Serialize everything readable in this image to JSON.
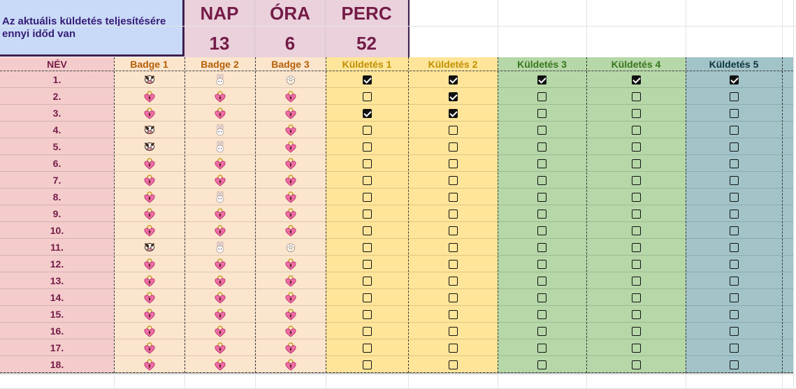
{
  "timer": {
    "info_text": "Az aktuális küldetés teljesítésére ennyi időd van",
    "units": [
      {
        "label": "NAP",
        "value": "13"
      },
      {
        "label": "ÓRA",
        "value": "6"
      },
      {
        "label": "PERC",
        "value": "52"
      }
    ]
  },
  "columns": [
    {
      "key": "name",
      "label": "NÉV",
      "color": "#741b47",
      "bg": "#f4cccc"
    },
    {
      "key": "badge1",
      "label": "Badge 1",
      "color": "#b45f06",
      "bg": "#fce5cd"
    },
    {
      "key": "badge2",
      "label": "Badge 2",
      "color": "#b45f06",
      "bg": "#fce5cd"
    },
    {
      "key": "badge3",
      "label": "Badge 3",
      "color": "#b45f06",
      "bg": "#fce5cd"
    },
    {
      "key": "mission1",
      "label": "Küldetés 1",
      "color": "#bf9000",
      "bg": "#ffe599"
    },
    {
      "key": "mission2",
      "label": "Küldetés 2",
      "color": "#bf9000",
      "bg": "#ffe599"
    },
    {
      "key": "mission3",
      "label": "Küldetés 3",
      "color": "#38761d",
      "bg": "#b6d7a8"
    },
    {
      "key": "mission4",
      "label": "Küldetés 4",
      "color": "#38761d",
      "bg": "#b6d7a8"
    },
    {
      "key": "mission5",
      "label": "Küldetés 5",
      "color": "#0c343d",
      "bg": "#a2c4c9"
    }
  ],
  "icon_names": {
    "cow": "cow-badge-icon",
    "bunny": "bunny-badge-icon",
    "sheep": "sheep-badge-icon",
    "lock": "heart-lock-icon"
  },
  "rows": [
    {
      "name": "1.",
      "badges": [
        "cow",
        "bunny",
        "sheep"
      ],
      "missions": [
        true,
        true,
        true,
        true,
        true
      ]
    },
    {
      "name": "2.",
      "badges": [
        "lock",
        "lock",
        "lock"
      ],
      "missions": [
        false,
        true,
        false,
        false,
        false
      ]
    },
    {
      "name": "3.",
      "badges": [
        "lock",
        "lock",
        "lock"
      ],
      "missions": [
        true,
        true,
        false,
        false,
        false
      ]
    },
    {
      "name": "4.",
      "badges": [
        "cow",
        "bunny",
        "lock"
      ],
      "missions": [
        false,
        false,
        false,
        false,
        false
      ]
    },
    {
      "name": "5.",
      "badges": [
        "cow",
        "bunny",
        "lock"
      ],
      "missions": [
        false,
        false,
        false,
        false,
        false
      ]
    },
    {
      "name": "6.",
      "badges": [
        "lock",
        "lock",
        "lock"
      ],
      "missions": [
        false,
        false,
        false,
        false,
        false
      ]
    },
    {
      "name": "7.",
      "badges": [
        "lock",
        "lock",
        "lock"
      ],
      "missions": [
        false,
        false,
        false,
        false,
        false
      ]
    },
    {
      "name": "8.",
      "badges": [
        "lock",
        "bunny",
        "lock"
      ],
      "missions": [
        false,
        false,
        false,
        false,
        false
      ]
    },
    {
      "name": "9.",
      "badges": [
        "lock",
        "lock",
        "lock"
      ],
      "missions": [
        false,
        false,
        false,
        false,
        false
      ]
    },
    {
      "name": "10.",
      "badges": [
        "lock",
        "lock",
        "lock"
      ],
      "missions": [
        false,
        false,
        false,
        false,
        false
      ]
    },
    {
      "name": "11.",
      "badges": [
        "cow",
        "bunny",
        "sheep"
      ],
      "missions": [
        false,
        false,
        false,
        false,
        false
      ]
    },
    {
      "name": "12.",
      "badges": [
        "lock",
        "lock",
        "lock"
      ],
      "missions": [
        false,
        false,
        false,
        false,
        false
      ]
    },
    {
      "name": "13.",
      "badges": [
        "lock",
        "lock",
        "lock"
      ],
      "missions": [
        false,
        false,
        false,
        false,
        false
      ]
    },
    {
      "name": "14.",
      "badges": [
        "lock",
        "lock",
        "lock"
      ],
      "missions": [
        false,
        false,
        false,
        false,
        false
      ]
    },
    {
      "name": "15.",
      "badges": [
        "lock",
        "lock",
        "lock"
      ],
      "missions": [
        false,
        false,
        false,
        false,
        false
      ]
    },
    {
      "name": "16.",
      "badges": [
        "lock",
        "lock",
        "lock"
      ],
      "missions": [
        false,
        false,
        false,
        false,
        false
      ]
    },
    {
      "name": "17.",
      "badges": [
        "lock",
        "lock",
        "lock"
      ],
      "missions": [
        false,
        false,
        false,
        false,
        false
      ]
    },
    {
      "name": "18.",
      "badges": [
        "lock",
        "lock",
        "lock"
      ],
      "missions": [
        false,
        false,
        false,
        false,
        false
      ]
    }
  ]
}
